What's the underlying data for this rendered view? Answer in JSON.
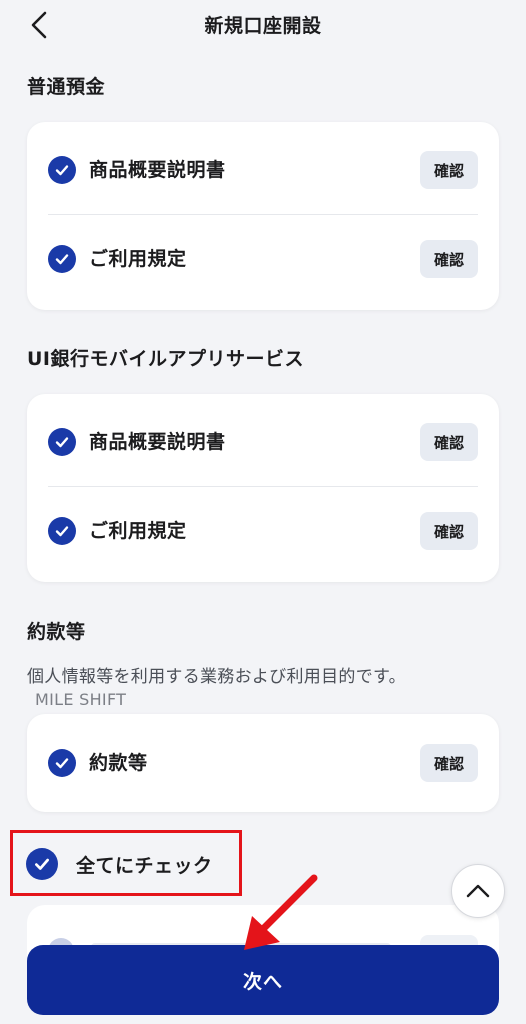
{
  "header": {
    "title": "新規口座開設",
    "back_icon": "chevron-left-icon"
  },
  "sections": [
    {
      "title": "普通預金",
      "items": [
        {
          "label": "商品概要説明書",
          "checked": true,
          "confirm_label": "確認"
        },
        {
          "label": "ご利用規定",
          "checked": true,
          "confirm_label": "確認"
        }
      ]
    },
    {
      "title": "UI銀行モバイルアプリサービス",
      "items": [
        {
          "label": "商品概要説明書",
          "checked": true,
          "confirm_label": "確認"
        },
        {
          "label": "ご利用規定",
          "checked": true,
          "confirm_label": "確認"
        }
      ]
    },
    {
      "title": "約款等",
      "description": "個人情報等を利用する業務および利用目的です。",
      "watermark": "MILE SHIFT",
      "items": [
        {
          "label": "約款等",
          "checked": true,
          "confirm_label": "確認"
        }
      ]
    }
  ],
  "check_all": {
    "label": "全てにチェック",
    "checked": true
  },
  "footer": {
    "next_label": "次へ"
  },
  "colors": {
    "accent": "#1a3aa8",
    "primary_button": "#0f2a96",
    "highlight": "#e4141a",
    "background": "#f3f4f7"
  }
}
